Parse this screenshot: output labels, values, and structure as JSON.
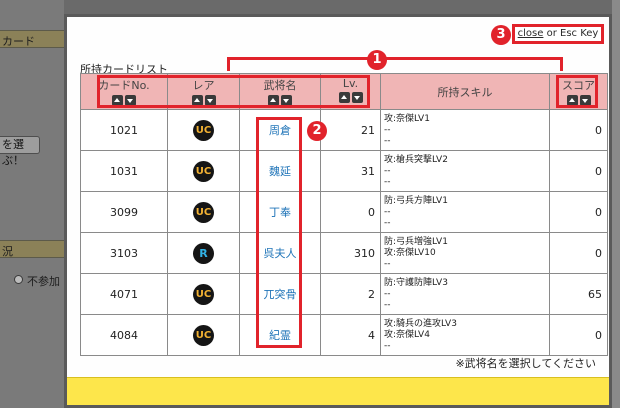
{
  "background": {
    "card_label": "カード",
    "choose_button": "を選ぶ！",
    "status_label": "況",
    "radio_label": "不参加"
  },
  "modal": {
    "close_link": "close",
    "close_rest": " or Esc Key",
    "title": "所持カードリスト",
    "footnote": "※武将名を選択してください",
    "badges": [
      "1",
      "2",
      "3"
    ]
  },
  "table": {
    "headers": [
      "カードNo.",
      "レア",
      "武将名",
      "Lv.",
      "所持スキル",
      "スコア"
    ],
    "rows": [
      {
        "no": "1021",
        "rarity": "UC",
        "name": "周倉",
        "lv": "21",
        "skills": [
          "攻:奈傑LV1",
          "--",
          "--"
        ],
        "score": "0"
      },
      {
        "no": "1031",
        "rarity": "UC",
        "name": "魏延",
        "lv": "31",
        "skills": [
          "攻:槍兵突撃LV2",
          "--",
          "--"
        ],
        "score": "0"
      },
      {
        "no": "3099",
        "rarity": "UC",
        "name": "丁奉",
        "lv": "0",
        "skills": [
          "防:弓兵方陣LV1",
          "--",
          "--"
        ],
        "score": "0"
      },
      {
        "no": "3103",
        "rarity": "R",
        "name": "呉夫人",
        "lv": "310",
        "skills": [
          "防:弓兵増強LV1",
          "攻:奈傑LV10",
          "--"
        ],
        "score": "0"
      },
      {
        "no": "4071",
        "rarity": "UC",
        "name": "兀突骨",
        "lv": "2",
        "skills": [
          "防:守護防陣LV3",
          "--",
          "--"
        ],
        "score": "65"
      },
      {
        "no": "4084",
        "rarity": "UC",
        "name": "紀霊",
        "lv": "4",
        "skills": [
          "攻:騎兵の進攻LV3",
          "攻:奈傑LV4",
          "--"
        ],
        "score": "0"
      }
    ]
  },
  "colors": {
    "header_bg": "#f0b5b5",
    "annotation_red": "#e1232b",
    "footer_yellow": "#fde64b",
    "rarity_uc": "#f3b233",
    "rarity_r": "#32b3e6",
    "link_blue": "#1f74b8"
  }
}
